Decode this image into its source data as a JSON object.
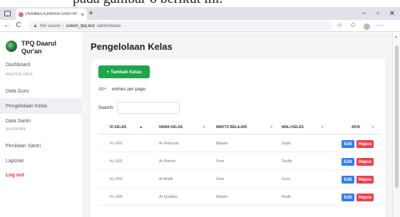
{
  "caption_text": "pada gambar 6 berikut ini.",
  "browser": {
    "tab_title": "PEMBELAJARAN SANTRI PADA TI",
    "tab_close": "×",
    "new_tab": "+",
    "min": "−",
    "max": "▫",
    "close": "✕",
    "back": "←",
    "reload": "C",
    "security": "Not secure",
    "url_host": "sistem_tpq.test",
    "url_path": "/admin/kelas",
    "star": "☆",
    "favorites": "✩",
    "menu": "⋯"
  },
  "sidebar": {
    "brand_line1": "TPQ Daarul",
    "brand_line2": "Qur'an",
    "items": [
      {
        "label": "Dashboard"
      },
      {
        "label": "Data Guru"
      },
      {
        "label": "Pengelolaan Kelas"
      },
      {
        "label": "Data Santri"
      },
      {
        "label": "Penilaian Santri"
      },
      {
        "label": "Laporan"
      },
      {
        "label": "Log out"
      }
    ],
    "sections": [
      "MASTER DATA",
      "AKADEMIK"
    ]
  },
  "main": {
    "title": "Pengelolaan Kelas",
    "add_button": "+ Tambah Kelas",
    "entries_value": "10",
    "entries_label": "entries per page",
    "search_label": "Search:",
    "columns": [
      "ID KELAS",
      "NAMA KELAS",
      "WAKTU BELAJAR",
      "WALI KELAS",
      "AKSI"
    ],
    "rows": [
      {
        "id": "KL-001",
        "nama": "Ar-Rahman",
        "waktu": "Malam",
        "wali": "Sabil"
      },
      {
        "id": "KL-002",
        "nama": "Ar-Rahim",
        "waktu": "Sore",
        "wali": "Taufik"
      },
      {
        "id": "KL-003",
        "nama": "Al-Malik",
        "waktu": "Sore",
        "wali": "Guru"
      },
      {
        "id": "KL-004",
        "nama": "Al-Quddus",
        "waktu": "Malam",
        "wali": "Radit"
      }
    ],
    "edit_label": "Edit",
    "delete_label": "Hapus"
  },
  "colors": {
    "primary_green": "#1ea64a",
    "edit_blue": "#2f7ff0",
    "delete_red": "#ef3e4a",
    "logout_red": "#e53935"
  }
}
